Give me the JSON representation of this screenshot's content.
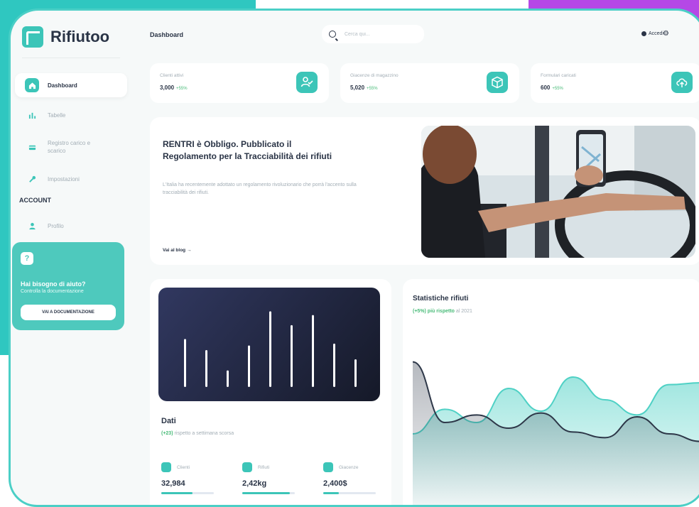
{
  "app": {
    "name": "Rifiutoo"
  },
  "sidebar": {
    "items": [
      {
        "label": "Dashboard",
        "icon": "home-icon"
      },
      {
        "label": "Tabelle",
        "icon": "bar-chart-icon"
      },
      {
        "label": "Registro carico e scarico",
        "icon": "credit-card-icon"
      },
      {
        "label": "Impostazioni",
        "icon": "wrench-icon"
      }
    ],
    "section_account": "ACCOUNT",
    "account_items": [
      {
        "label": "Profilo",
        "icon": "user-icon"
      }
    ],
    "help": {
      "title": "Hai bisogno di aiuto?",
      "subtitle": "Controlla la documentazione",
      "button": "VAI A DOCUMENTAZIONE"
    }
  },
  "header": {
    "title": "Dashboard",
    "search_placeholder": "Cerca qui...",
    "login_label": "Accedi"
  },
  "stats": [
    {
      "label": "Clienti attivi",
      "value": "3,000",
      "delta": "+55%",
      "icon": "user-check-icon"
    },
    {
      "label": "Giacenze di magazzino",
      "value": "5,020",
      "delta": "+55%",
      "icon": "box-icon"
    },
    {
      "label": "Formulari caricati",
      "value": "600",
      "delta": "+55%",
      "icon": "upload-cloud-icon"
    }
  ],
  "hero": {
    "title": "RENTRI è Obbligo. Pubblicato il Regolamento per la Tracciabilità dei rifiuti",
    "description": "L'Italia ha recentemente adottato un regolamento rivoluzionario che porrà l'accento sulla tracciabilità dei rifiuti.",
    "link": "Vai al blog"
  },
  "dati": {
    "title": "Dati",
    "subtitle_highlight": "(+23)",
    "subtitle_rest": "rispetto a settimana scorsa",
    "bars": [
      0.52,
      0.4,
      0.18,
      0.45,
      0.82,
      0.67,
      0.78,
      0.47,
      0.3
    ],
    "metrics": [
      {
        "label": "Clienti",
        "value": "32,984",
        "progress": 0.6,
        "icon": "wallet-icon"
      },
      {
        "label": "Rifiuti",
        "value": "2,42kg",
        "progress": 0.9,
        "icon": "rocket-icon"
      },
      {
        "label": "Giacenze",
        "value": "2,400$",
        "progress": 0.3,
        "icon": "cart-icon"
      }
    ]
  },
  "statistiche": {
    "title": "Statistiche rifiuti",
    "subtitle_highlight": "(+5%) più rispetto",
    "subtitle_rest": "al 2021"
  },
  "chart_data": {
    "type": "area",
    "series": [
      {
        "values": [
          1.2,
          2.5,
          1.8,
          3.6,
          2.4,
          4.2,
          3.0,
          2.2,
          3.8,
          3.9
        ]
      },
      {
        "values": [
          5.0,
          1.8,
          2.2,
          1.5,
          2.3,
          1.3,
          1.0,
          2.1,
          1.2,
          0.8
        ]
      }
    ],
    "colors": [
      "#4fd1c5",
      "#2d3748"
    ],
    "ylim": [
      0,
      6
    ]
  }
}
